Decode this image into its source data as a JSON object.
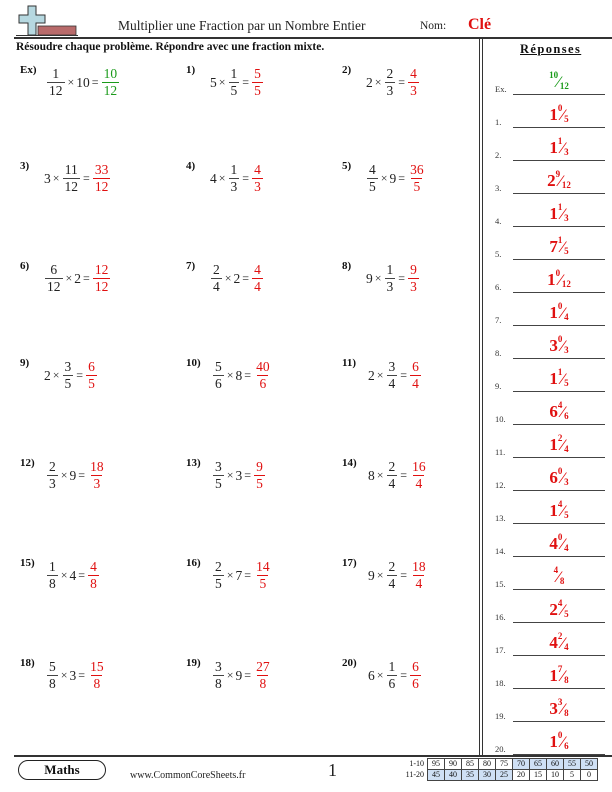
{
  "header": {
    "logo_icon": "plus-sign-logo-icon",
    "title": "Multiplier une Fraction par un Nombre Entier",
    "name_label": "Nom:",
    "name_value": "Clé"
  },
  "instructions": "Résoudre chaque problème. Répondre avec une fraction mixte.",
  "colors": {
    "answer": "#e01010",
    "example": "#1a9a1a",
    "score_highlight": "#cfe0f5"
  },
  "problems": [
    {
      "label": "Ex)",
      "a": "1/12",
      "b": "10",
      "order": "frac-first",
      "result_num": "10",
      "result_den": "12",
      "example": true
    },
    {
      "label": "1)",
      "a": "1/5",
      "b": "5",
      "order": "whole-first",
      "result_num": "5",
      "result_den": "5"
    },
    {
      "label": "2)",
      "a": "2/3",
      "b": "2",
      "order": "whole-first",
      "result_num": "4",
      "result_den": "3"
    },
    {
      "label": "3)",
      "a": "11/12",
      "b": "3",
      "order": "whole-first",
      "result_num": "33",
      "result_den": "12"
    },
    {
      "label": "4)",
      "a": "1/3",
      "b": "4",
      "order": "whole-first",
      "result_num": "4",
      "result_den": "3"
    },
    {
      "label": "5)",
      "a": "4/5",
      "b": "9",
      "order": "frac-first",
      "result_num": "36",
      "result_den": "5"
    },
    {
      "label": "6)",
      "a": "6/12",
      "b": "2",
      "order": "frac-first",
      "result_num": "12",
      "result_den": "12"
    },
    {
      "label": "7)",
      "a": "2/4",
      "b": "2",
      "order": "frac-first",
      "result_num": "4",
      "result_den": "4"
    },
    {
      "label": "8)",
      "a": "1/3",
      "b": "9",
      "order": "whole-first",
      "result_num": "9",
      "result_den": "3"
    },
    {
      "label": "9)",
      "a": "3/5",
      "b": "2",
      "order": "whole-first",
      "result_num": "6",
      "result_den": "5"
    },
    {
      "label": "10)",
      "a": "5/6",
      "b": "8",
      "order": "frac-first",
      "result_num": "40",
      "result_den": "6"
    },
    {
      "label": "11)",
      "a": "3/4",
      "b": "2",
      "order": "whole-first",
      "result_num": "6",
      "result_den": "4"
    },
    {
      "label": "12)",
      "a": "2/3",
      "b": "9",
      "order": "frac-first",
      "result_num": "18",
      "result_den": "3"
    },
    {
      "label": "13)",
      "a": "3/5",
      "b": "3",
      "order": "frac-first",
      "result_num": "9",
      "result_den": "5"
    },
    {
      "label": "14)",
      "a": "2/4",
      "b": "8",
      "order": "whole-first",
      "result_num": "16",
      "result_den": "4"
    },
    {
      "label": "15)",
      "a": "1/8",
      "b": "4",
      "order": "frac-first",
      "result_num": "4",
      "result_den": "8"
    },
    {
      "label": "16)",
      "a": "2/5",
      "b": "7",
      "order": "frac-first",
      "result_num": "14",
      "result_den": "5"
    },
    {
      "label": "17)",
      "a": "2/4",
      "b": "9",
      "order": "whole-first",
      "result_num": "18",
      "result_den": "4"
    },
    {
      "label": "18)",
      "a": "5/8",
      "b": "3",
      "order": "frac-first",
      "result_num": "15",
      "result_den": "8"
    },
    {
      "label": "19)",
      "a": "3/8",
      "b": "9",
      "order": "frac-first",
      "result_num": "27",
      "result_den": "8"
    },
    {
      "label": "20)",
      "a": "1/6",
      "b": "6",
      "order": "whole-first",
      "result_num": "6",
      "result_den": "6"
    }
  ],
  "answer_key": {
    "title": "Réponses",
    "items": [
      {
        "num": "Ex.",
        "whole": "",
        "sup": "10",
        "sub": "12",
        "example": true
      },
      {
        "num": "1.",
        "whole": "1",
        "sup": "0",
        "sub": "5"
      },
      {
        "num": "2.",
        "whole": "1",
        "sup": "1",
        "sub": "3"
      },
      {
        "num": "3.",
        "whole": "2",
        "sup": "9",
        "sub": "12"
      },
      {
        "num": "4.",
        "whole": "1",
        "sup": "1",
        "sub": "3"
      },
      {
        "num": "5.",
        "whole": "7",
        "sup": "1",
        "sub": "5"
      },
      {
        "num": "6.",
        "whole": "1",
        "sup": "0",
        "sub": "12"
      },
      {
        "num": "7.",
        "whole": "1",
        "sup": "0",
        "sub": "4"
      },
      {
        "num": "8.",
        "whole": "3",
        "sup": "0",
        "sub": "3"
      },
      {
        "num": "9.",
        "whole": "1",
        "sup": "1",
        "sub": "5"
      },
      {
        "num": "10.",
        "whole": "6",
        "sup": "4",
        "sub": "6"
      },
      {
        "num": "11.",
        "whole": "1",
        "sup": "2",
        "sub": "4"
      },
      {
        "num": "12.",
        "whole": "6",
        "sup": "0",
        "sub": "3"
      },
      {
        "num": "13.",
        "whole": "1",
        "sup": "4",
        "sub": "5"
      },
      {
        "num": "14.",
        "whole": "4",
        "sup": "0",
        "sub": "4"
      },
      {
        "num": "15.",
        "whole": "",
        "sup": "4",
        "sub": "8"
      },
      {
        "num": "16.",
        "whole": "2",
        "sup": "4",
        "sub": "5"
      },
      {
        "num": "17.",
        "whole": "4",
        "sup": "2",
        "sub": "4"
      },
      {
        "num": "18.",
        "whole": "1",
        "sup": "7",
        "sub": "8"
      },
      {
        "num": "19.",
        "whole": "3",
        "sup": "3",
        "sub": "8"
      },
      {
        "num": "20.",
        "whole": "1",
        "sup": "0",
        "sub": "6"
      }
    ]
  },
  "footer": {
    "badge": "Maths",
    "site": "www.CommonCoreSheets.fr",
    "page": "1",
    "score_table": {
      "rows": [
        {
          "label": "1-10",
          "values": [
            "95",
            "90",
            "85",
            "80",
            "75",
            "70",
            "65",
            "60",
            "55",
            "50"
          ],
          "highlight": [
            false,
            false,
            false,
            false,
            false,
            true,
            true,
            true,
            true,
            true
          ]
        },
        {
          "label": "11-20",
          "values": [
            "45",
            "40",
            "35",
            "30",
            "25",
            "20",
            "15",
            "10",
            "5",
            "0"
          ],
          "highlight": [
            true,
            true,
            true,
            true,
            true,
            false,
            false,
            false,
            false,
            false
          ]
        }
      ]
    }
  }
}
